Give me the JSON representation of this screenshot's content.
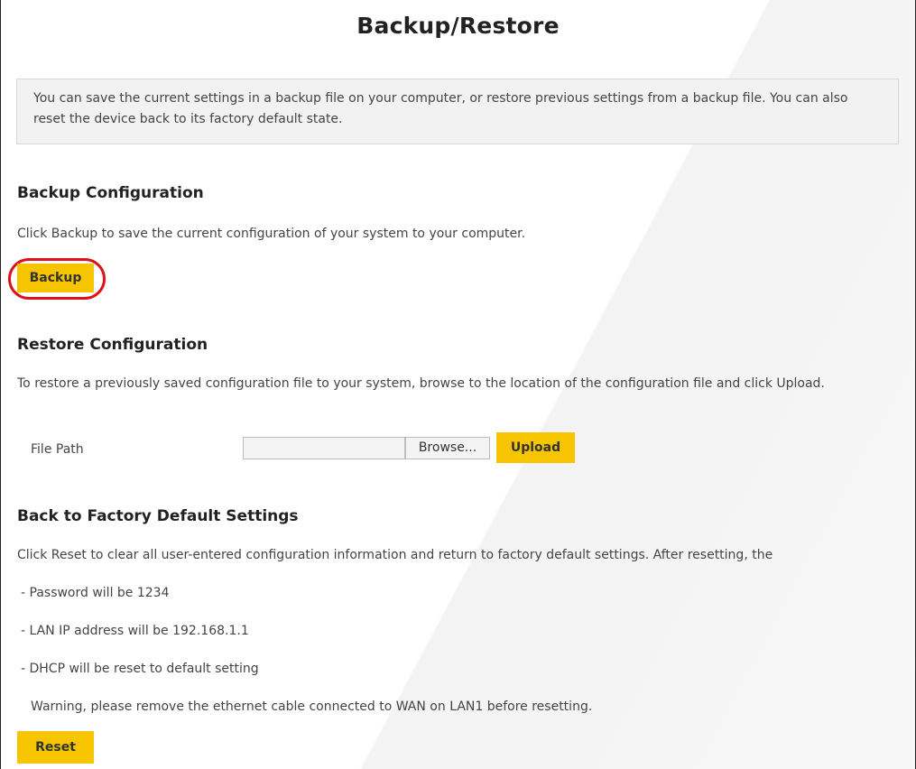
{
  "page": {
    "title": "Backup/Restore",
    "intro": "You can save the current settings in a backup file on your computer, or restore previous settings from a backup file. You can also reset the device back to its factory default state."
  },
  "backup": {
    "title": "Backup Configuration",
    "description": "Click Backup to save the current configuration of your system to your computer.",
    "button_label": "Backup"
  },
  "restore": {
    "title": "Restore Configuration",
    "description": "To restore a previously saved configuration file to your system, browse to the location of the configuration file and click Upload.",
    "file_path_label": "File Path",
    "file_path_value": "",
    "browse_label": "Browse...",
    "upload_label": "Upload"
  },
  "factory": {
    "title": "Back to Factory Default Settings",
    "description": "Click Reset to clear all user-entered configuration information and return to factory default settings. After resetting, the",
    "items": [
      "- Password will be 1234",
      "- LAN IP address will be 192.168.1.1",
      "- DHCP will be reset to default setting"
    ],
    "warning": "Warning, please remove the ethernet cable connected to WAN on LAN1 before resetting.",
    "reset_label": "Reset"
  },
  "colors": {
    "button": "#f7c400",
    "highlight": "#e0101a",
    "info_box": "#f2f2f2"
  }
}
